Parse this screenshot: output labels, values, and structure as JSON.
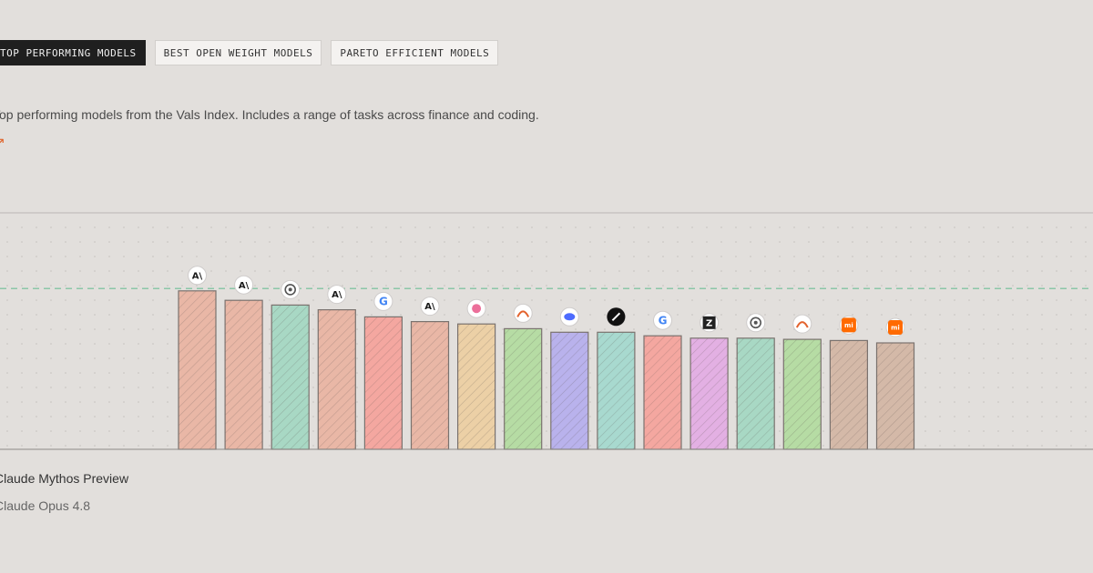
{
  "tabs": [
    {
      "label": "TOP PERFORMING MODELS",
      "active": true
    },
    {
      "label": "BEST OPEN WEIGHT MODELS",
      "active": false
    },
    {
      "label": "PARETO EFFICIENT MODELS",
      "active": false
    }
  ],
  "description": "Top performing models from the Vals Index. Includes a range of tasks across finance and coding.",
  "selected": {
    "name": "Claude Mythos Preview",
    "subtitle": "Claude Opus 4.8"
  },
  "chart_data": {
    "type": "bar",
    "ylim": [
      0,
      100
    ],
    "grid": true,
    "reference_line": 68,
    "bars": [
      {
        "value": 67,
        "color": "#e9b7a6",
        "icon": "anthropic-icon"
      },
      {
        "value": 63,
        "color": "#e9b7a6",
        "icon": "anthropic-icon"
      },
      {
        "value": 61,
        "color": "#a8d8c4",
        "icon": "openai-icon"
      },
      {
        "value": 59,
        "color": "#e9b7a6",
        "icon": "anthropic-icon"
      },
      {
        "value": 56,
        "color": "#f4a7a0",
        "icon": "google-icon"
      },
      {
        "value": 54,
        "color": "#e9b7a6",
        "icon": "anthropic-icon"
      },
      {
        "value": 53,
        "color": "#ecd0a6",
        "icon": "kimi-icon"
      },
      {
        "value": 51,
        "color": "#b6dca4",
        "icon": "qwen-icon"
      },
      {
        "value": 49.5,
        "color": "#b9b2ec",
        "icon": "deepseek-icon"
      },
      {
        "value": 49.5,
        "color": "#a8d9cf",
        "icon": "xai-icon"
      },
      {
        "value": 48,
        "color": "#f4a7a0",
        "icon": "google-icon"
      },
      {
        "value": 47,
        "color": "#e3b0e3",
        "icon": "zhipu-icon"
      },
      {
        "value": 47,
        "color": "#a8d8c4",
        "icon": "openai-icon"
      },
      {
        "value": 46.5,
        "color": "#b6dca4",
        "icon": "qwen-icon"
      },
      {
        "value": 46,
        "color": "#d4b9a8",
        "icon": "xiaomi-icon"
      },
      {
        "value": 45,
        "color": "#d4b9a8",
        "icon": "xiaomi-icon"
      }
    ]
  }
}
